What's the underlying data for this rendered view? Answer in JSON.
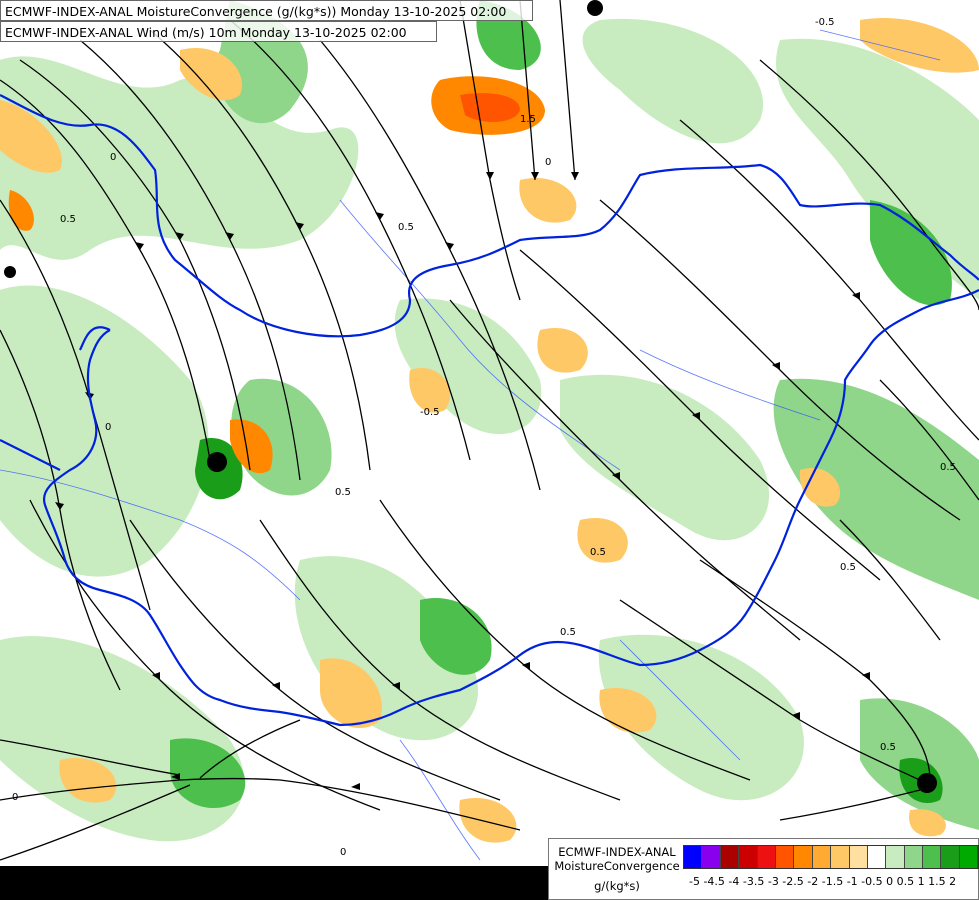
{
  "titles": {
    "line1": "ECMWF-INDEX-ANAL MoistureConvergence (g/(kg*s)) Monday 13-10-2025 02:00",
    "line2": "ECMWF-INDEX-ANAL Wind (m/s) 10m Monday 13-10-2025 02:00"
  },
  "legend": {
    "title": "ECMWF-INDEX-ANAL MoistureConvergence",
    "unit": "g/(kg*s)",
    "ticks": "-5 -4.5 -4 -3.5 -3 -2.5 -2 -1.5 -1 -0.5 0  0.5  1  1.5  2",
    "colors": [
      "#0000ff",
      "#8800ee",
      "#aa0000",
      "#cc0000",
      "#ee1111",
      "#ff5500",
      "#ff8800",
      "#ffaa33",
      "#ffc866",
      "#ffe0a0",
      "#ffffff",
      "#c8ecc0",
      "#8fd68a",
      "#4cbf4c",
      "#1a9e1a",
      "#00aa00"
    ]
  },
  "contour_labels": [
    "0.5",
    "0",
    "0.5",
    "0",
    "-0.5",
    "1.5",
    "0.5",
    "0.5",
    "0",
    "0.5",
    "0",
    "0.5",
    "0",
    "0.5",
    "-0.5",
    "0.5"
  ],
  "colors": {
    "border": "#0022dd",
    "river": "#3355ff",
    "streamline": "#000000",
    "positive": "#8fd68a",
    "positive_strong": "#1a9e1a",
    "negative": "#ffc866",
    "negative_strong": "#ff8800"
  }
}
